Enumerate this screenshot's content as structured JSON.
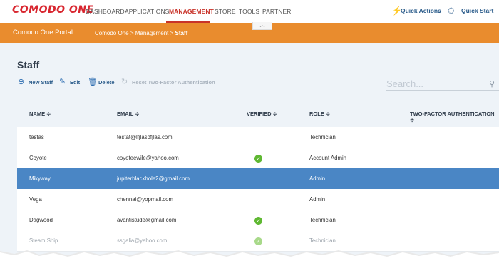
{
  "brand": {
    "logo": "COMODO ONE"
  },
  "nav": {
    "items": [
      "DASHBOARD",
      "APPLICATIONS",
      "MANAGEMENT",
      "STORE",
      "TOOLS",
      "PARTNER"
    ],
    "active": "MANAGEMENT",
    "quick_actions": "Quick Actions",
    "quick_start": "Quick Start"
  },
  "portal_bar": {
    "title": "Comodo One Portal",
    "breadcrumb": {
      "link": "Comodo One",
      "mid": " > Management > ",
      "current": "Staff"
    }
  },
  "page": {
    "title": "Staff"
  },
  "toolbar": {
    "new_staff": "New Staff",
    "edit": "Edit",
    "delete": "Delete",
    "reset_2fa": "Reset Two-Factor Authentication"
  },
  "search": {
    "placeholder": "Search..."
  },
  "table": {
    "columns": {
      "name": "NAME ≑",
      "email": "EMAIL ≑",
      "verified": "VERIFIED ≑",
      "role": "ROLE ≑",
      "two_factor": "TWO-FACTOR AUTHENTICATION ≑"
    },
    "rows": [
      {
        "name": "testas",
        "email": "testat@lfjlasdfjlas.com",
        "verified": false,
        "role": "Technician"
      },
      {
        "name": "Coyote",
        "email": "coyoteewile@yahoo.com",
        "verified": true,
        "role": "Account Admin"
      },
      {
        "name": "Mikyway",
        "email": "jupiterblackhole2@gmail.com",
        "verified": false,
        "role": "Admin"
      },
      {
        "name": "Vega",
        "email": "chennai@yopmail.com",
        "verified": false,
        "role": "Admin"
      },
      {
        "name": "Dagwood",
        "email": "avantistude@gmail.com",
        "verified": true,
        "role": "Technician"
      },
      {
        "name": "Steam Ship",
        "email": "ssgalia@yahoo.com",
        "verified": true,
        "role": "Technician"
      }
    ]
  },
  "colors": {
    "brand_red": "#d8262f",
    "portal_orange": "#e98c2e",
    "selected_row": "#4a86c5",
    "verified_green": "#5fb832"
  }
}
